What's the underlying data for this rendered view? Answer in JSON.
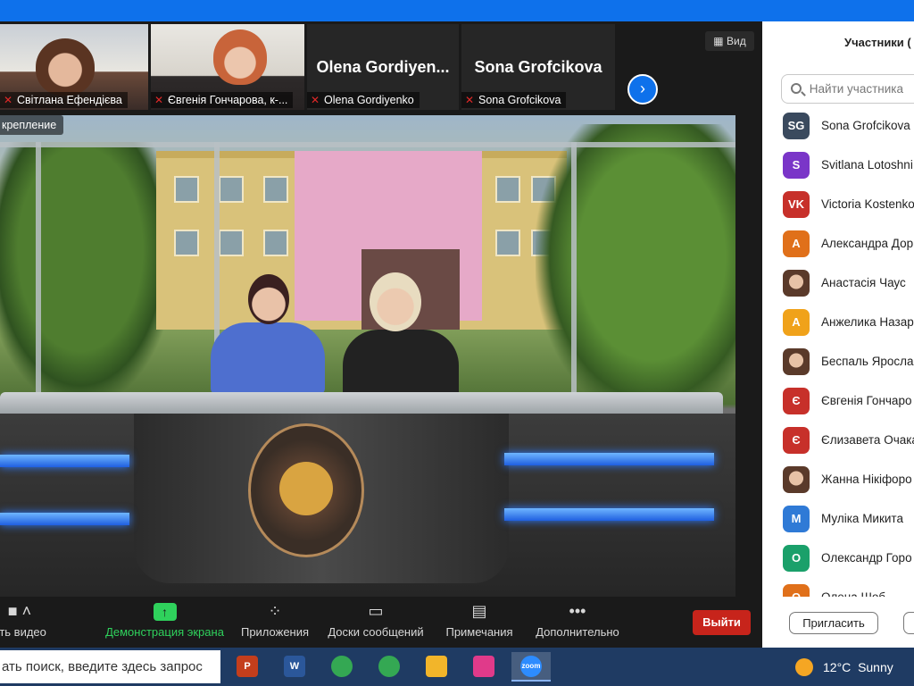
{
  "colors": {
    "accent": "#0e71eb",
    "leave": "#c7241b",
    "share": "#2fd15c",
    "muted_mic": "#e02828",
    "taskbar": "#1f3b63"
  },
  "thumbnails": [
    {
      "name": "Світлана Ефендієва",
      "muted": true,
      "type": "video"
    },
    {
      "name": "Євгенія Гончарова, к-...",
      "muted": true,
      "type": "video"
    },
    {
      "name": "Olena Gordiyenko",
      "big_name": "Olena  Gordiyen...",
      "muted": true,
      "type": "name"
    },
    {
      "name": "Sona Grofcikova",
      "big_name": "Sona Grofcikova",
      "muted": true,
      "type": "name"
    }
  ],
  "view_button": {
    "icon": "grid-icon",
    "label": "Вид"
  },
  "next_button": {
    "icon": "chevron-right-icon",
    "glyph": "›"
  },
  "main_video": {
    "pin_label": "крепление"
  },
  "toolbar": {
    "video": {
      "label": "ить видео",
      "icon": "video-camera-icon"
    },
    "share": {
      "label": "Демонстрация экрана",
      "icon": "share-screen-icon",
      "glyph": "↑"
    },
    "apps": {
      "label": "Приложения",
      "icon": "apps-icon"
    },
    "whiteboards": {
      "label": "Доски сообщений",
      "icon": "whiteboard-icon"
    },
    "notes": {
      "label": "Примечания",
      "icon": "notes-icon"
    },
    "more": {
      "label": "Дополнительно",
      "icon": "more-dots-icon"
    },
    "leave": {
      "label": "Выйти"
    }
  },
  "panel": {
    "title": "Участники (",
    "search_placeholder": "Найти участника",
    "participants": [
      {
        "initials": "SG",
        "name": "Sona Grofcikova",
        "color": "#3a4a5e"
      },
      {
        "initials": "S",
        "name": "Svitlana Lotoshni",
        "color": "#7a35c8"
      },
      {
        "initials": "VK",
        "name": "Victoria Kostenko",
        "color": "#c7302a"
      },
      {
        "initials": "A",
        "name": "Александра Дор",
        "color": "#e0701a"
      },
      {
        "initials": "",
        "name": "Анастасія Чаус",
        "color": "",
        "photo": true
      },
      {
        "initials": "A",
        "name": "Анжелика Назар",
        "color": "#f0a21a"
      },
      {
        "initials": "",
        "name": "Беспаль Ярослав",
        "color": "",
        "photo": true
      },
      {
        "initials": "Є",
        "name": "Євгенія Гончаро",
        "color": "#c7302a"
      },
      {
        "initials": "Є",
        "name": "Єлизавета Очака",
        "color": "#c7302a"
      },
      {
        "initials": "",
        "name": "Жанна Нікіфоро",
        "color": "",
        "photo": true
      },
      {
        "initials": "M",
        "name": "Муліка Микита",
        "color": "#2f7ad6"
      },
      {
        "initials": "O",
        "name": "Олександр Горо",
        "color": "#1aa06a"
      },
      {
        "initials": "O",
        "name": "Олена Шоб...",
        "color": "#e0701a"
      }
    ],
    "invite_label": "Пригласить"
  },
  "taskbar": {
    "search_text": "ать поиск, введите здесь запрос",
    "apps": [
      {
        "icon": "powerpoint-icon",
        "letter": "P",
        "color": "#c43e1c"
      },
      {
        "icon": "word-icon",
        "letter": "W",
        "color": "#2b579a"
      },
      {
        "icon": "chrome-icon",
        "letter": "",
        "color": "#34a853"
      },
      {
        "icon": "chrome-profile-icon",
        "letter": "",
        "color": "#34a853"
      },
      {
        "icon": "file-explorer-icon",
        "letter": "",
        "color": "#f2b52a"
      },
      {
        "icon": "paint-icon",
        "letter": "",
        "color": "#e03a8a"
      },
      {
        "icon": "zoom-icon",
        "letter": "zoom",
        "color": "#2d8cff"
      }
    ],
    "weather": {
      "temp": "12°C",
      "condition": "Sunny",
      "icon": "sun-icon"
    }
  }
}
